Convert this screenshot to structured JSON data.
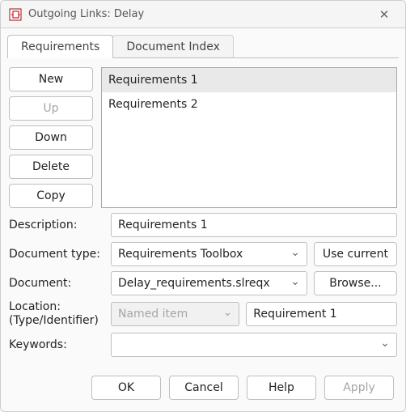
{
  "window": {
    "title": "Outgoing Links: Delay"
  },
  "tabs": [
    {
      "id": "requirements",
      "label": "Requirements",
      "active": true
    },
    {
      "id": "document-index",
      "label": "Document Index",
      "active": false
    }
  ],
  "side_buttons": {
    "new": "New",
    "up": "Up",
    "down": "Down",
    "delete": "Delete",
    "copy": "Copy"
  },
  "requirements_list": {
    "items": [
      {
        "label": "Requirements 1",
        "selected": true
      },
      {
        "label": "Requirements 2",
        "selected": false
      }
    ]
  },
  "fields": {
    "description_label": "Description:",
    "description_value": "Requirements 1",
    "doc_type_label": "Document type:",
    "doc_type_value": "Requirements Toolbox",
    "use_current_label": "Use current",
    "document_label": "Document:",
    "document_value": "Delay_requirements.slreqx",
    "browse_label": "Browse...",
    "location_label": "Location:\n(Type/Identifier)",
    "location_type_value": "Named item",
    "location_id_value": "Requirement 1",
    "keywords_label": "Keywords:",
    "keywords_value": ""
  },
  "footer": {
    "ok": "OK",
    "cancel": "Cancel",
    "help": "Help",
    "apply": "Apply"
  }
}
